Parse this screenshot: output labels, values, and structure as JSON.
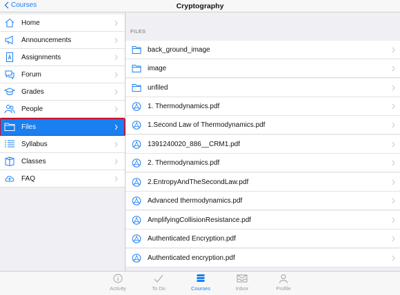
{
  "navbar": {
    "back_label": "Courses",
    "title": "Cryptography"
  },
  "sidebar": {
    "items": [
      {
        "label": "Home",
        "icon": "home-icon"
      },
      {
        "label": "Announcements",
        "icon": "megaphone-icon"
      },
      {
        "label": "Assignments",
        "icon": "assignment-icon"
      },
      {
        "label": "Forum",
        "icon": "forum-icon"
      },
      {
        "label": "Grades",
        "icon": "grades-icon"
      },
      {
        "label": "People",
        "icon": "people-icon"
      },
      {
        "label": "Files",
        "icon": "folder-icon",
        "selected": true
      },
      {
        "label": "Syllabus",
        "icon": "syllabus-icon"
      },
      {
        "label": "Classes",
        "icon": "classes-icon"
      },
      {
        "label": "FAQ",
        "icon": "cloud-icon"
      }
    ]
  },
  "files": {
    "header": "FILES",
    "items": [
      {
        "name": "back_ground_image",
        "type": "folder"
      },
      {
        "name": "image",
        "type": "folder"
      },
      {
        "name": "unfiled",
        "type": "folder"
      },
      {
        "name": "1. Thermodynamics.pdf",
        "type": "pdf"
      },
      {
        "name": "1.Second Law of Thermodynamics.pdf",
        "type": "pdf"
      },
      {
        "name": "1391240020_886__CRM1.pdf",
        "type": "pdf"
      },
      {
        "name": "2. Thermodynamics.pdf",
        "type": "pdf"
      },
      {
        "name": "2.EntropyAndTheSecondLaw.pdf",
        "type": "pdf"
      },
      {
        "name": "Advanced thermodynamics.pdf",
        "type": "pdf"
      },
      {
        "name": "AmplifyingCollisionResistance.pdf",
        "type": "pdf"
      },
      {
        "name": "Authenticated Encryption.pdf",
        "type": "pdf"
      },
      {
        "name": "Authenticated encryption.pdf",
        "type": "pdf"
      }
    ]
  },
  "tabbar": {
    "tabs": [
      {
        "label": "Activity",
        "icon": "info-icon"
      },
      {
        "label": "To Do",
        "icon": "checkmark-icon"
      },
      {
        "label": "Courses",
        "icon": "courses-icon",
        "selected": true
      },
      {
        "label": "Inbox",
        "icon": "inbox-icon"
      },
      {
        "label": "Profile",
        "icon": "profile-icon"
      }
    ]
  },
  "colors": {
    "accent": "#1a7ff0",
    "selection_outline": "#c8102e"
  }
}
